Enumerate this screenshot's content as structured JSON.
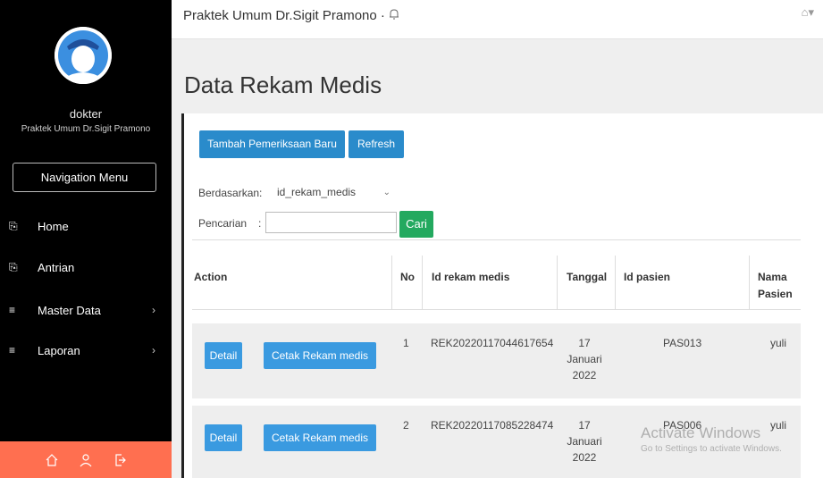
{
  "app": {
    "title": "Praktek Umum Dr.Sigit Pramono ·"
  },
  "sidebar": {
    "role": "dokter",
    "clinic": "Praktek Umum Dr.Sigit Pramono",
    "nav_title": "Navigation Menu",
    "items": [
      {
        "label": "Home",
        "icon": "file-icon",
        "icon_glyph": "⎘"
      },
      {
        "label": "Antrian",
        "icon": "file-icon",
        "icon_glyph": "⎘"
      },
      {
        "label": "Master Data",
        "icon": "menu-icon",
        "icon_glyph": "≡",
        "chevron": "›"
      },
      {
        "label": "Laporan",
        "icon": "menu-icon",
        "icon_glyph": "≡",
        "chevron": "›"
      }
    ],
    "footer_icons": [
      "home-icon",
      "user-icon",
      "logout-icon"
    ],
    "footer_color": "#ff6f50"
  },
  "header": {
    "user_menu_icon": "user-icon",
    "user_menu_glyph": "⌂▾"
  },
  "main": {
    "page_title": "Data Rekam Medis",
    "add_button": "Tambah Pemeriksaan Baru",
    "refresh_button": "Refresh",
    "filter_label": "Berdasarkan:",
    "filter_value": "id_rekam_medis",
    "search_label": "Pencarian",
    "search_colon": ":",
    "search_value": "",
    "search_button": "Cari",
    "colors": {
      "primary": "#2a8bcb",
      "success": "#23a95f"
    }
  },
  "table": {
    "columns": [
      "Action",
      "No",
      "Id rekam medis",
      "Tanggal",
      "Id pasien",
      "Nama Pasien"
    ],
    "action_detail": "Detail",
    "action_print": "Cetak Rekam medis",
    "rows": [
      {
        "no": "1",
        "id_rekam_medis": "REK20220117044617654",
        "tanggal": "17 Januari 2022",
        "id_pasien": "PAS013",
        "nama_pasien": "yuli"
      },
      {
        "no": "2",
        "id_rekam_medis": "REK20220117085228474",
        "tanggal": "17 Januari 2022",
        "id_pasien": "PAS006",
        "nama_pasien": "yuli"
      }
    ]
  },
  "watermark": {
    "title": "Activate Windows",
    "subtitle": "Go to Settings to activate Windows."
  }
}
